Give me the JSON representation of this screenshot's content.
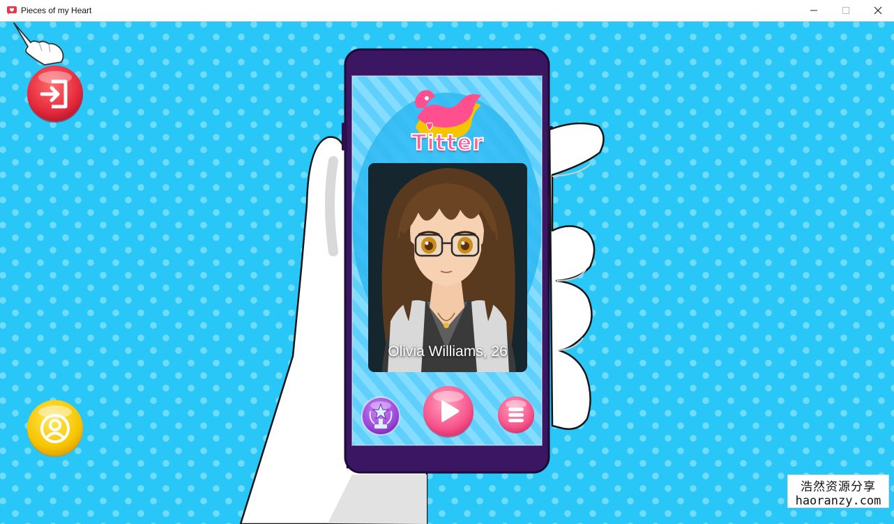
{
  "window": {
    "title": "Pieces of my Heart",
    "minimize_glyph": "—",
    "maximize_glyph": "☐",
    "close_glyph": "✕"
  },
  "app": {
    "logo_text": "Titter"
  },
  "profile_card": {
    "caption": "Olivia Williams, 26"
  },
  "buttons": {
    "exit": "exit-icon",
    "profile": "user-icon",
    "achievements": "trophy-star-icon",
    "play": "play-icon",
    "menu": "menu-icon"
  },
  "watermark": {
    "line1": "浩然资源分享",
    "line2": "haoranzy.com"
  },
  "colors": {
    "background": "#28c7f7",
    "dots": "#6fdcfb",
    "phone_frame": "#3b1763",
    "exit_button": "#e4293c",
    "profile_button": "#f7c500",
    "play_button": "#f7548a",
    "achievement_button": "#9b47d8"
  }
}
